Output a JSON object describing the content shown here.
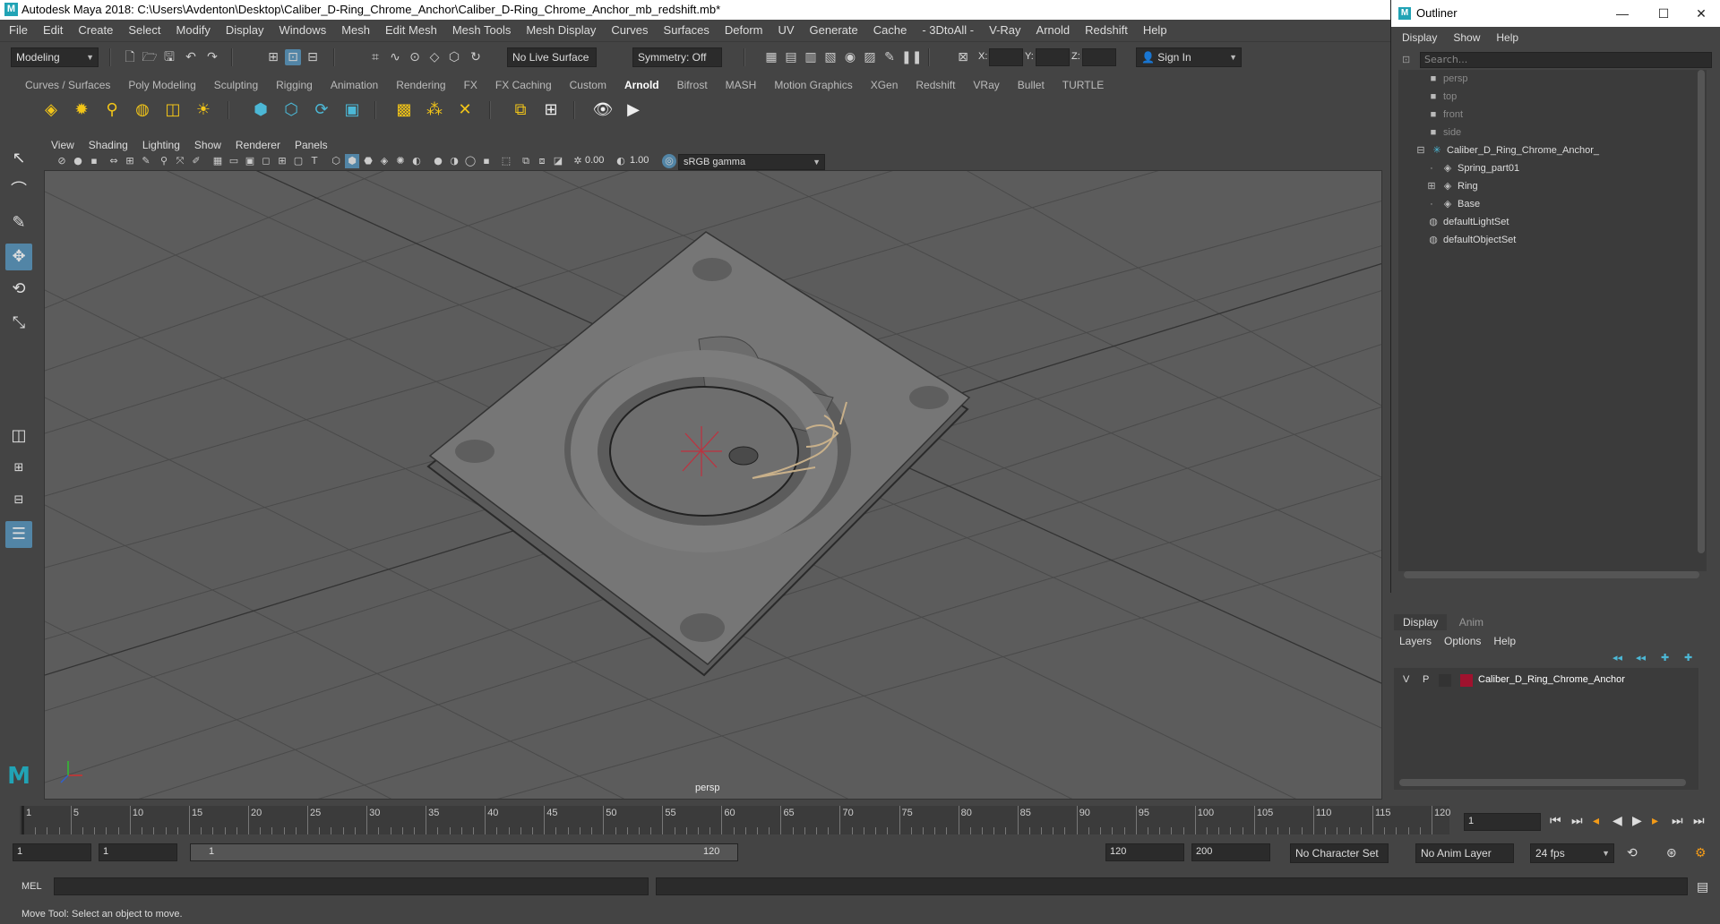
{
  "window": {
    "title": "Autodesk Maya 2018: C:\\Users\\Avdenton\\Desktop\\Caliber_D-Ring_Chrome_Anchor\\Caliber_D-Ring_Chrome_Anchor_mb_redshift.mb*"
  },
  "menubar": [
    "File",
    "Edit",
    "Create",
    "Select",
    "Modify",
    "Display",
    "Windows",
    "Mesh",
    "Edit Mesh",
    "Mesh Tools",
    "Mesh Display",
    "Curves",
    "Surfaces",
    "Deform",
    "UV",
    "Generate",
    "Cache",
    "- 3DtoAll -",
    "V-Ray",
    "Arnold",
    "Redshift",
    "Help"
  ],
  "statusline": {
    "mode": "Modeling",
    "live_surface": "No Live Surface",
    "symmetry": "Symmetry: Off",
    "x_label": "X:",
    "y_label": "Y:",
    "z_label": "Z:",
    "sign_in": "Sign In"
  },
  "shelf": {
    "tabs": [
      "Curves / Surfaces",
      "Poly Modeling",
      "Sculpting",
      "Rigging",
      "Animation",
      "Rendering",
      "FX",
      "FX Caching",
      "Custom",
      "Arnold",
      "Bifrost",
      "MASH",
      "Motion Graphics",
      "XGen",
      "Redshift",
      "VRay",
      "Bullet",
      "TURTLE"
    ],
    "active_tab": "Arnold"
  },
  "viewport": {
    "menu": [
      "View",
      "Shading",
      "Lighting",
      "Show",
      "Renderer",
      "Panels"
    ],
    "exposure": "0.00",
    "gamma": "1.00",
    "color_space": "sRGB gamma",
    "camera_label": "persp"
  },
  "outliner": {
    "title": "Outliner",
    "menu": [
      "Display",
      "Show",
      "Help"
    ],
    "search_placeholder": "Search...",
    "nodes": [
      {
        "label": "persp",
        "icon": "camera-icon",
        "indent": 0,
        "dim": true
      },
      {
        "label": "top",
        "icon": "camera-icon",
        "indent": 0,
        "dim": true
      },
      {
        "label": "front",
        "icon": "camera-icon",
        "indent": 0,
        "dim": true
      },
      {
        "label": "side",
        "icon": "camera-icon",
        "indent": 0,
        "dim": true
      },
      {
        "label": "Caliber_D_Ring_Chrome_Anchor_",
        "icon": "group-icon",
        "indent": 0,
        "dim": false
      },
      {
        "label": "Spring_part01",
        "icon": "mesh-icon",
        "indent": 1,
        "dim": false
      },
      {
        "label": "Ring",
        "icon": "mesh-icon",
        "indent": 1,
        "dim": false
      },
      {
        "label": "Base",
        "icon": "mesh-icon",
        "indent": 1,
        "dim": false
      },
      {
        "label": "defaultLightSet",
        "icon": "set-icon",
        "indent": 0,
        "dim": false
      },
      {
        "label": "defaultObjectSet",
        "icon": "set-icon",
        "indent": 0,
        "dim": false
      }
    ]
  },
  "layer_editor": {
    "tabs": [
      "Display",
      "Anim"
    ],
    "menu": [
      "Layers",
      "Options",
      "Help"
    ],
    "layers": [
      {
        "v": "V",
        "p": "P",
        "name": "Caliber_D_Ring_Chrome_Anchor",
        "color": "#a0122e"
      }
    ]
  },
  "timeline": {
    "ticks": [
      1,
      5,
      10,
      15,
      20,
      25,
      30,
      35,
      40,
      45,
      50,
      55,
      60,
      65,
      70,
      75,
      80,
      85,
      90,
      95,
      100,
      105,
      110,
      115,
      120
    ],
    "current_frame": "1"
  },
  "range": {
    "start": "1",
    "playback_start": "1",
    "range_start": "1",
    "range_end": "120",
    "playback_end": "120",
    "end": "200",
    "character_set": "No Character Set",
    "anim_layer": "No Anim Layer",
    "fps": "24 fps"
  },
  "command": {
    "language": "MEL"
  },
  "help_line": "Move Tool: Select an object to move.",
  "colors": {
    "accent": "#5285a6",
    "maya_brand": "#21a3b5",
    "layer_color": "#a0122e"
  }
}
